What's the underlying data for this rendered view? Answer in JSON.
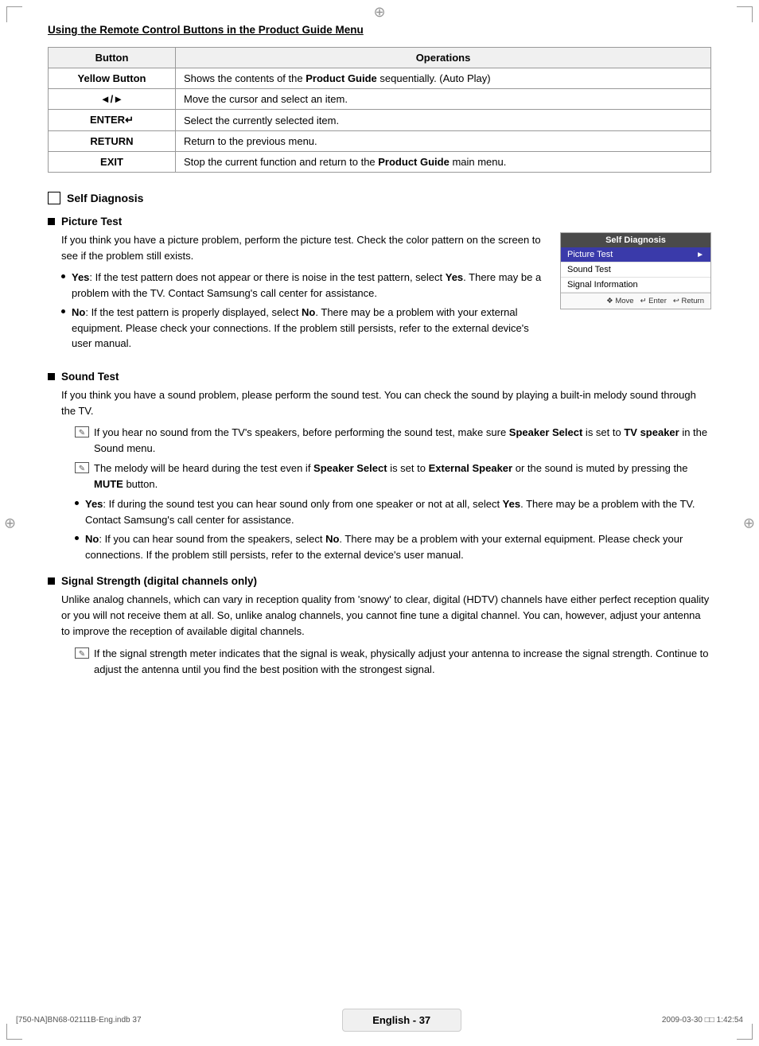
{
  "page": {
    "corners": [
      "tl",
      "tr",
      "bl",
      "br"
    ],
    "crosshairs": [
      "top",
      "left",
      "right"
    ]
  },
  "section_title": "Using the Remote Control Buttons in the Product Guide Menu",
  "table": {
    "headers": [
      "Button",
      "Operations"
    ],
    "rows": [
      {
        "button": "Yellow Button",
        "operation": "Shows the contents of the **Product Guide** sequentially. (Auto Play)"
      },
      {
        "button": "◄/►",
        "operation": "Move the cursor and select an item."
      },
      {
        "button": "ENTER↵",
        "operation": "Select the currently selected item."
      },
      {
        "button": "RETURN",
        "operation": "Return to the previous menu."
      },
      {
        "button": "EXIT",
        "operation": "Stop the current function and return to the **Product Guide** main menu."
      }
    ]
  },
  "self_diagnosis": {
    "section_label": "Self Diagnosis",
    "picture_test": {
      "title": "Picture Test",
      "intro": "If you think you have a picture problem, perform the picture test. Check the color pattern on the screen to see if the problem still exists.",
      "bullets": [
        {
          "label": "Yes",
          "text": ": If the test pattern does not appear or there is noise in the test pattern, select Yes. There may be a problem with the TV. Contact Samsung's call center for assistance."
        },
        {
          "label": "No",
          "text": ": If the test pattern is properly displayed, select No. There may be a problem with your external equipment. Please check your connections. If the problem still persists, refer to the external device's user manual."
        }
      ],
      "tv_screenshot": {
        "title": "Self Diagnosis",
        "items": [
          {
            "label": "Picture Test",
            "arrow": "►",
            "highlighted": true
          },
          {
            "label": "Sound Test",
            "arrow": "",
            "highlighted": false
          },
          {
            "label": "Signal Information",
            "arrow": "",
            "highlighted": false
          }
        ],
        "footer": [
          "❖ Move",
          "↵ Enter",
          "↩ Return"
        ]
      }
    },
    "sound_test": {
      "title": "Sound Test",
      "intro": "If you think you have a sound problem, please perform the sound test. You can check the sound by playing a built-in melody sound through the TV.",
      "notes": [
        "If you hear no sound from the TV's speakers, before performing the sound test, make sure **Speaker Select** is set to **TV speaker** in the Sound menu.",
        "The melody will be heard during the test even if **Speaker Select** is set to **External Speaker** or the sound is muted by pressing the **MUTE** button."
      ],
      "bullets": [
        {
          "label": "Yes",
          "text": ": If during the sound test you can hear sound only from one speaker or not at all, select Yes. There may be a problem with the TV. Contact Samsung's call center for assistance."
        },
        {
          "label": "No",
          "text": ": If you can hear sound from the speakers, select No. There may be a problem with your external equipment. Please check your connections. If the problem still persists, refer to the external device's user manual."
        }
      ]
    },
    "signal_strength": {
      "title": "Signal Strength (digital channels only)",
      "intro": "Unlike analog channels, which can vary in reception quality from 'snowy' to clear, digital (HDTV) channels have either perfect reception quality or you will not receive them at all. So, unlike analog channels, you cannot fine tune a digital channel. You can, however, adjust your antenna to improve the reception of available digital channels.",
      "note": "If the signal strength meter indicates that the signal is weak, physically adjust your antenna to increase the signal strength. Continue to adjust the antenna until you find the best position with the strongest signal."
    }
  },
  "footer": {
    "left": "[750-NA]BN68-02111B-Eng.indb   37",
    "center": "English - 37",
    "right": "2009-03-30   □□ 1:42:54"
  }
}
